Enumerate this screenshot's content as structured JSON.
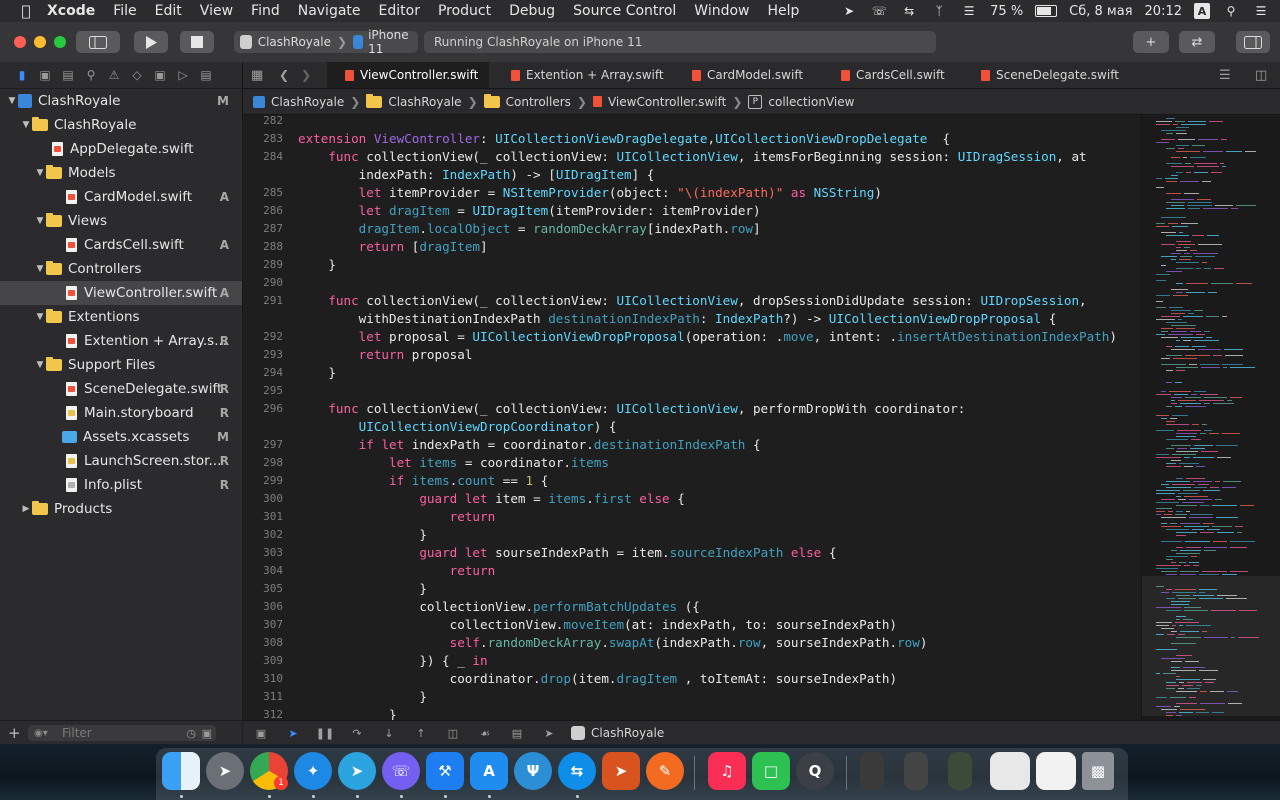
{
  "menubar": {
    "app": "Xcode",
    "items": [
      "File",
      "Edit",
      "View",
      "Find",
      "Navigate",
      "Editor",
      "Product",
      "Debug",
      "Source Control",
      "Window",
      "Help"
    ],
    "battery": "75 %",
    "battery_level": 0.75,
    "date": "Сб, 8 мая",
    "time": "20:12",
    "input": "A"
  },
  "toolbar": {
    "scheme_name": "ClashRoyale",
    "device": "iPhone 11",
    "activity": "Running ClashRoyale on iPhone 11"
  },
  "navigator": {
    "filter_placeholder": "Filter",
    "items": [
      {
        "label": "ClashRoyale",
        "badge": "M"
      },
      {
        "label": "ClashRoyale",
        "badge": ""
      },
      {
        "label": "AppDelegate.swift",
        "badge": ""
      },
      {
        "label": "Models",
        "badge": ""
      },
      {
        "label": "CardModel.swift",
        "badge": "A"
      },
      {
        "label": "Views",
        "badge": ""
      },
      {
        "label": "CardsCell.swift",
        "badge": "A"
      },
      {
        "label": "Controllers",
        "badge": ""
      },
      {
        "label": "ViewController.swift",
        "badge": "A"
      },
      {
        "label": "Extentions",
        "badge": ""
      },
      {
        "label": "Extention + Array.s...",
        "badge": "R"
      },
      {
        "label": "Support Files",
        "badge": ""
      },
      {
        "label": "SceneDelegate.swift",
        "badge": "R"
      },
      {
        "label": "Main.storyboard",
        "badge": "R"
      },
      {
        "label": "Assets.xcassets",
        "badge": "M"
      },
      {
        "label": "LaunchScreen.stor...",
        "badge": "R"
      },
      {
        "label": "Info.plist",
        "badge": "R"
      },
      {
        "label": "Products",
        "badge": ""
      }
    ]
  },
  "tabs": [
    "ViewController.swift",
    "Extention + Array.swift",
    "CardModel.swift",
    "CardsCell.swift",
    "SceneDelegate.swift"
  ],
  "jumpbar": [
    "ClashRoyale",
    "ClashRoyale",
    "Controllers",
    "ViewController.swift",
    "P",
    "collectionView"
  ],
  "code": {
    "lines": [
      {
        "n": "282",
        "t": ""
      },
      {
        "n": "283",
        "t": "extension ViewController: UICollectionViewDragDelegate,UICollectionViewDropDelegate  {"
      },
      {
        "n": "284",
        "t": "    func collectionView(_ collectionView: UICollectionView, itemsForBeginning session: UIDragSession, at"
      },
      {
        "n": "",
        "t": "        indexPath: IndexPath) -> [UIDragItem] {"
      },
      {
        "n": "285",
        "t": "        let itemProvider = NSItemProvider(object: \"\\(indexPath)\" as NSString)"
      },
      {
        "n": "286",
        "t": "        let dragItem = UIDragItem(itemProvider: itemProvider)"
      },
      {
        "n": "287",
        "t": "        dragItem.localObject = randomDeckArray[indexPath.row]"
      },
      {
        "n": "288",
        "t": "        return [dragItem]"
      },
      {
        "n": "289",
        "t": "    }"
      },
      {
        "n": "290",
        "t": ""
      },
      {
        "n": "291",
        "t": "    func collectionView(_ collectionView: UICollectionView, dropSessionDidUpdate session: UIDropSession,"
      },
      {
        "n": "",
        "t": "        withDestinationIndexPath destinationIndexPath: IndexPath?) -> UICollectionViewDropProposal {"
      },
      {
        "n": "292",
        "t": "        let proposal = UICollectionViewDropProposal(operation: .move, intent: .insertAtDestinationIndexPath)"
      },
      {
        "n": "293",
        "t": "        return proposal"
      },
      {
        "n": "294",
        "t": "    }"
      },
      {
        "n": "295",
        "t": ""
      },
      {
        "n": "296",
        "t": "    func collectionView(_ collectionView: UICollectionView, performDropWith coordinator:"
      },
      {
        "n": "",
        "t": "        UICollectionViewDropCoordinator) {"
      },
      {
        "n": "297",
        "t": "        if let indexPath = coordinator.destinationIndexPath {"
      },
      {
        "n": "298",
        "t": "            let items = coordinator.items"
      },
      {
        "n": "299",
        "t": "            if items.count == 1 {"
      },
      {
        "n": "300",
        "t": "                guard let item = items.first else {"
      },
      {
        "n": "301",
        "t": "                    return"
      },
      {
        "n": "302",
        "t": "                }"
      },
      {
        "n": "303",
        "t": "                guard let sourseIndexPath = item.sourceIndexPath else {"
      },
      {
        "n": "304",
        "t": "                    return"
      },
      {
        "n": "305",
        "t": "                }"
      },
      {
        "n": "306",
        "t": "                collectionView.performBatchUpdates ({"
      },
      {
        "n": "307",
        "t": "                    collectionView.moveItem(at: indexPath, to: sourseIndexPath)"
      },
      {
        "n": "308",
        "t": "                    self.randomDeckArray.swapAt(indexPath.row, sourseIndexPath.row)"
      },
      {
        "n": "309",
        "t": "                }) { _ in"
      },
      {
        "n": "310",
        "t": "                    coordinator.drop(item.dragItem , toItemAt: sourseIndexPath)"
      },
      {
        "n": "311",
        "t": "                }"
      },
      {
        "n": "312",
        "t": "            }"
      }
    ]
  },
  "debugbar": {
    "target": "ClashRoyale"
  },
  "dock": {
    "badge": "1",
    "icons": [
      "finder-icon",
      "launchpad-icon",
      "chrome-icon",
      "safari-icon",
      "telegram-icon",
      "viber-icon",
      "xcode-icon",
      "app-store-icon",
      "fork-icon",
      "teamviewer-icon",
      "rocket-icon",
      "sketch-icon",
      "music-icon",
      "facetime-icon",
      "quicktime-icon",
      "preview-thumb-1",
      "preview-thumb-2",
      "preview-thumb-3",
      "preview-thumb-4",
      "preview-thumb-5",
      "trash-icon"
    ]
  },
  "colors": {
    "keyword": "#fc5fa3",
    "type": "#5dd8ff",
    "custom_type": "#a167e6",
    "function": "#67b7a4",
    "property": "#41a1c0",
    "string": "#fc6a5d",
    "number": "#d0bf69",
    "accent": "#3a8dff"
  }
}
